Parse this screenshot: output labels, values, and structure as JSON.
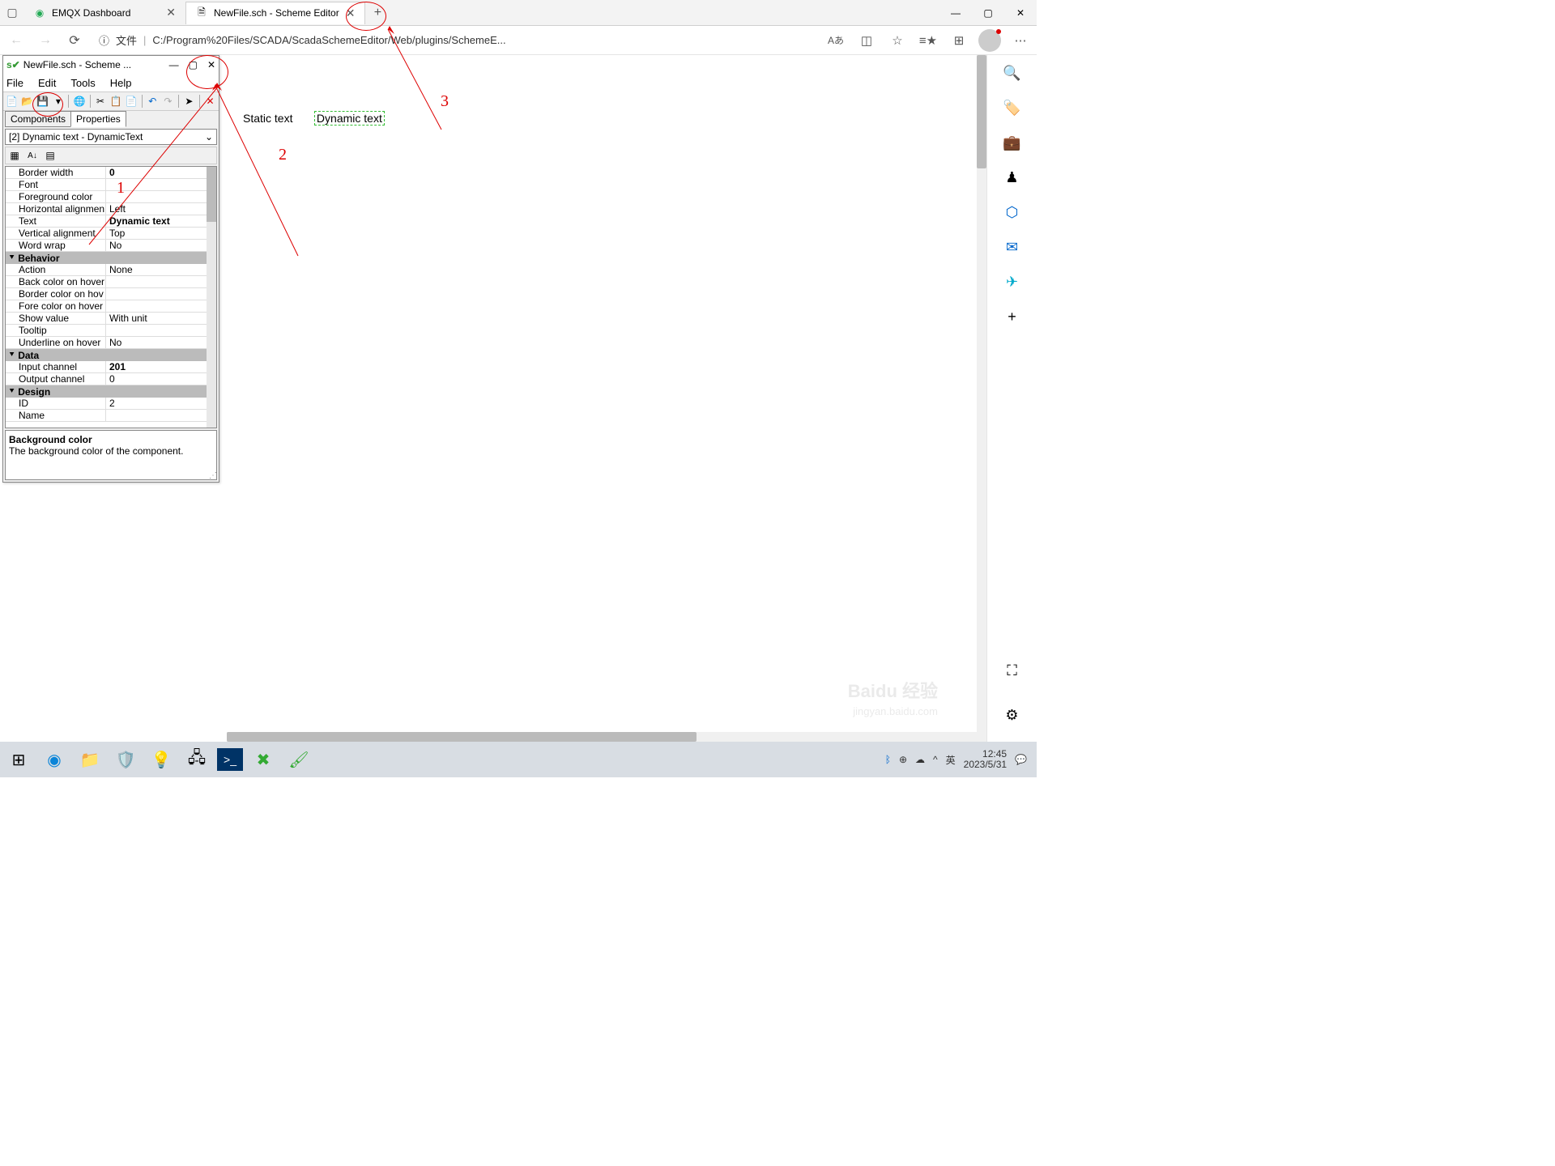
{
  "browser": {
    "tabs": [
      {
        "title": "EMQX Dashboard"
      },
      {
        "title": "NewFile.sch - Scheme Editor"
      }
    ],
    "url_label": "文件",
    "url": "C:/Program%20Files/SCADA/ScadaSchemeEditor/Web/plugins/SchemeE...",
    "reading_icon": "Aあ"
  },
  "scheme": {
    "title": "NewFile.sch - Scheme ...",
    "menu": [
      "File",
      "Edit",
      "Tools",
      "Help"
    ],
    "tabs": [
      "Components",
      "Properties"
    ],
    "selected_object": "[2] Dynamic text - DynamicText",
    "props": [
      {
        "type": "row",
        "k": "Border width",
        "v": "0",
        "bold": true
      },
      {
        "type": "row",
        "k": "Font",
        "v": ""
      },
      {
        "type": "row",
        "k": "Foreground color",
        "v": ""
      },
      {
        "type": "row",
        "k": "Horizontal alignmen",
        "v": "Left"
      },
      {
        "type": "row",
        "k": "Text",
        "v": "Dynamic text",
        "bold": true
      },
      {
        "type": "row",
        "k": "Vertical alignment",
        "v": "Top"
      },
      {
        "type": "row",
        "k": "Word wrap",
        "v": "No"
      },
      {
        "type": "cat",
        "k": "Behavior"
      },
      {
        "type": "row",
        "k": "Action",
        "v": "None"
      },
      {
        "type": "row",
        "k": "Back color on hover",
        "v": ""
      },
      {
        "type": "row",
        "k": "Border color on hov",
        "v": ""
      },
      {
        "type": "row",
        "k": "Fore color on hover",
        "v": ""
      },
      {
        "type": "row",
        "k": "Show value",
        "v": "With unit"
      },
      {
        "type": "row",
        "k": "Tooltip",
        "v": ""
      },
      {
        "type": "row",
        "k": "Underline on hover",
        "v": "No"
      },
      {
        "type": "cat",
        "k": "Data"
      },
      {
        "type": "row",
        "k": "Input channel",
        "v": "201",
        "bold": true
      },
      {
        "type": "row",
        "k": "Output channel",
        "v": "0"
      },
      {
        "type": "cat",
        "k": "Design"
      },
      {
        "type": "row",
        "k": "ID",
        "v": "2"
      },
      {
        "type": "row",
        "k": "Name",
        "v": ""
      }
    ],
    "desc_title": "Background color",
    "desc_text": "The background color of the component."
  },
  "canvas": {
    "static": "Static text",
    "dynamic": "Dynamic text"
  },
  "annotations": {
    "a1": "1",
    "a2": "2",
    "a3": "3"
  },
  "tray": {
    "ime": "英",
    "time": "12:45",
    "date": "2023/5/31"
  },
  "watermark": "Baidu 经验",
  "wm2": "jingyan.baidu.com"
}
